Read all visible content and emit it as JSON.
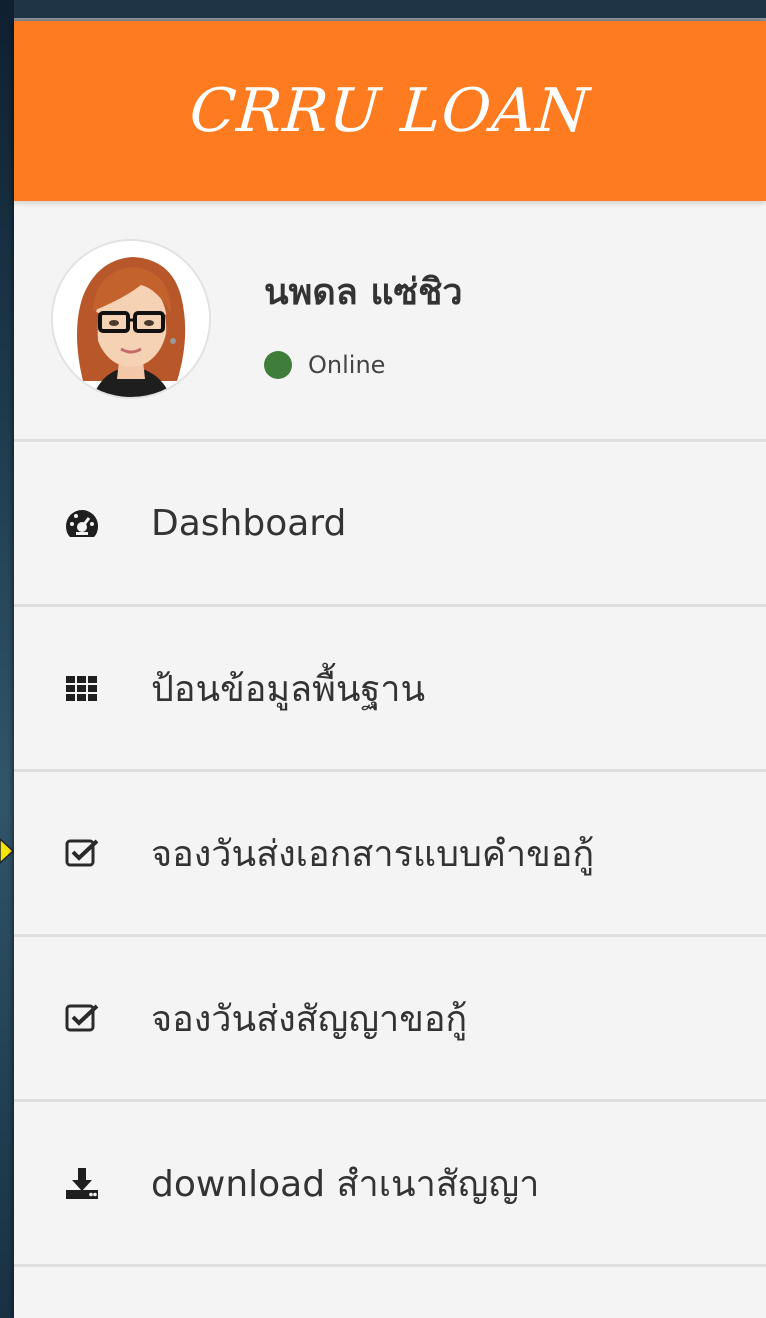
{
  "brand": {
    "title": "CRRU LOAN"
  },
  "user": {
    "name": "นพดล แซ่ชิว",
    "status": "Online",
    "status_color": "#3e7e3a"
  },
  "menu": {
    "items": [
      {
        "label": "Dashboard",
        "icon": "dashboard-icon"
      },
      {
        "label": "ป้อนข้อมูลพื้นฐาน",
        "icon": "grid-icon"
      },
      {
        "label": "จองวันส่งเอกสารแบบคำขอกู้",
        "icon": "checkbox-icon"
      },
      {
        "label": "จองวันส่งสัญญาขอกู้",
        "icon": "checkbox-icon"
      },
      {
        "label": "download สำเนาสัญญา",
        "icon": "download-icon"
      }
    ]
  },
  "colors": {
    "brand": "#ff7b1f",
    "sidebar_bg": "#f4f4f4",
    "text": "#333333",
    "pointer": "#f5e60a"
  }
}
